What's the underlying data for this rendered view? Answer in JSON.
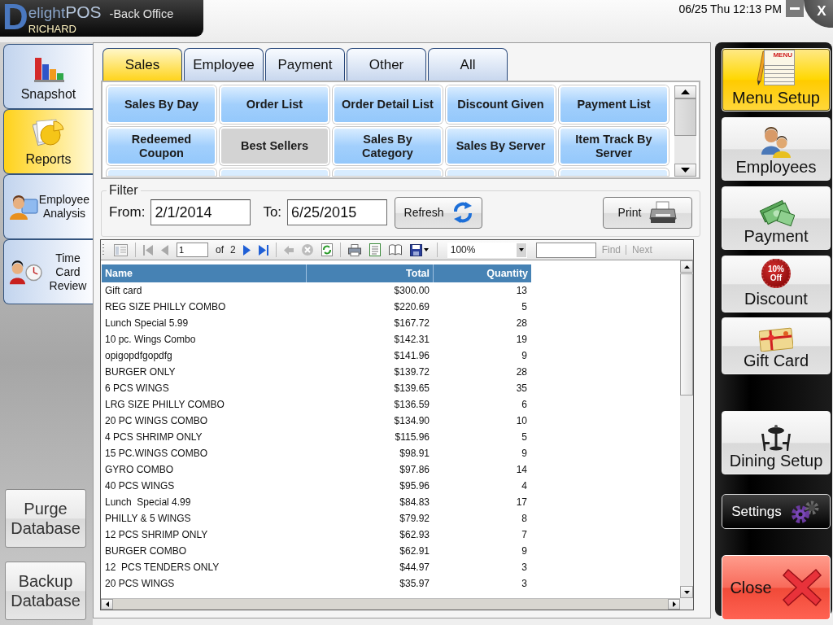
{
  "header": {
    "logo": {
      "initial": "D",
      "text": "elight",
      "suffix": "POS"
    },
    "subtitle": "-Back Office",
    "user": "RICHARD",
    "datetime": "06/25 Thu 12:13 PM",
    "close_label": "X"
  },
  "left_nav": {
    "items": [
      {
        "label": "Snapshot",
        "kind": "stacked",
        "selected": false
      },
      {
        "label": "Reports",
        "kind": "stacked",
        "selected": true
      },
      {
        "label": "Employee Analysis",
        "kind": "inline",
        "selected": false
      },
      {
        "label": "Time Card Review",
        "kind": "inline",
        "selected": false
      }
    ],
    "actions": [
      {
        "label": "Purge Database"
      },
      {
        "label": "Backup Database"
      }
    ]
  },
  "tabs": [
    {
      "label": "Sales",
      "selected": true
    },
    {
      "label": "Employee",
      "selected": false
    },
    {
      "label": "Payment",
      "selected": false
    },
    {
      "label": "Other",
      "selected": false
    },
    {
      "label": "All",
      "selected": false
    }
  ],
  "report_buttons": [
    {
      "label": "Sales By Day",
      "selected": false
    },
    {
      "label": "Order List",
      "selected": false
    },
    {
      "label": "Order Detail List",
      "selected": false
    },
    {
      "label": "Discount Given",
      "selected": false
    },
    {
      "label": "Payment List",
      "selected": false
    },
    {
      "label": "Redeemed Coupon",
      "selected": false
    },
    {
      "label": "Best Sellers",
      "selected": true
    },
    {
      "label": "Sales By Category",
      "selected": false
    },
    {
      "label": "Sales By Server",
      "selected": false
    },
    {
      "label": "Item Track By Server",
      "selected": false
    }
  ],
  "filter": {
    "title": "Filter",
    "from_label": "From:",
    "from_value": "2/1/2014",
    "to_label": "To:",
    "to_value": "6/25/2015",
    "refresh_label": "Refresh",
    "print_label": "Print"
  },
  "viewer_toolbar": {
    "first_page": {
      "disabled": true
    },
    "previous_page": {
      "disabled": true
    },
    "page": "1",
    "of_label": "of",
    "page_count": "2",
    "next_page": {
      "disabled": false
    },
    "last_page": {
      "disabled": false
    },
    "back": {
      "disabled": true
    },
    "stop": {
      "disabled": true
    },
    "zoom": "100%",
    "find": {
      "label": "Find",
      "disabled": true
    },
    "next": {
      "label": "Next",
      "disabled": true
    }
  },
  "table": {
    "columns": [
      "Name",
      "Total",
      "Quantity"
    ],
    "rows": [
      [
        "Gift card",
        "$300.00",
        "13"
      ],
      [
        "REG SIZE PHILLY COMBO",
        "$220.69",
        "5"
      ],
      [
        "Lunch Special 5.99",
        "$167.72",
        "28"
      ],
      [
        "10 pc. Wings Combo",
        "$142.31",
        "19"
      ],
      [
        "opigopdfgopdfg",
        "$141.96",
        "9"
      ],
      [
        "BURGER ONLY",
        "$139.72",
        "28"
      ],
      [
        "6 PCS WINGS",
        "$139.65",
        "35"
      ],
      [
        "LRG SIZE PHILLY COMBO",
        "$136.59",
        "6"
      ],
      [
        "20 PC WINGS COMBO",
        "$134.90",
        "10"
      ],
      [
        "4 PCS SHRIMP ONLY",
        "$115.96",
        "5"
      ],
      [
        "15 PC.WINGS COMBO",
        "$98.91",
        "9"
      ],
      [
        "GYRO COMBO",
        "$97.86",
        "14"
      ],
      [
        "40 PCS WINGS",
        "$95.96",
        "4"
      ],
      [
        "Lunch  Special 4.99",
        "$84.83",
        "17"
      ],
      [
        "PHILLY & 5 WINGS",
        "$79.92",
        "8"
      ],
      [
        "12 PCS SHRIMP ONLY",
        "$62.93",
        "7"
      ],
      [
        "BURGER COMBO",
        "$62.91",
        "9"
      ],
      [
        "12  PCS TENDERS ONLY",
        "$44.97",
        "3"
      ],
      [
        "20 PCS WINGS",
        "$35.97",
        "3"
      ]
    ]
  },
  "right_nav": {
    "items": [
      {
        "label": "Menu Setup",
        "kind": "tile",
        "selected": true,
        "icon_text": [
          "MENU"
        ]
      },
      {
        "label": "Employees",
        "kind": "tile",
        "selected": false
      },
      {
        "label": "Payment",
        "kind": "tile",
        "selected": false
      },
      {
        "label": "Discount",
        "kind": "tile",
        "selected": false,
        "icon_text": [
          "10%",
          "Off"
        ]
      },
      {
        "label": "Gift Card",
        "kind": "tile",
        "selected": false
      }
    ],
    "lower_items": [
      {
        "label": "Dining Setup",
        "kind": "tile",
        "selected": false
      },
      {
        "label": "Settings",
        "kind": "dark",
        "selected": false
      },
      {
        "label": "Close",
        "kind": "danger",
        "selected": false
      }
    ]
  }
}
